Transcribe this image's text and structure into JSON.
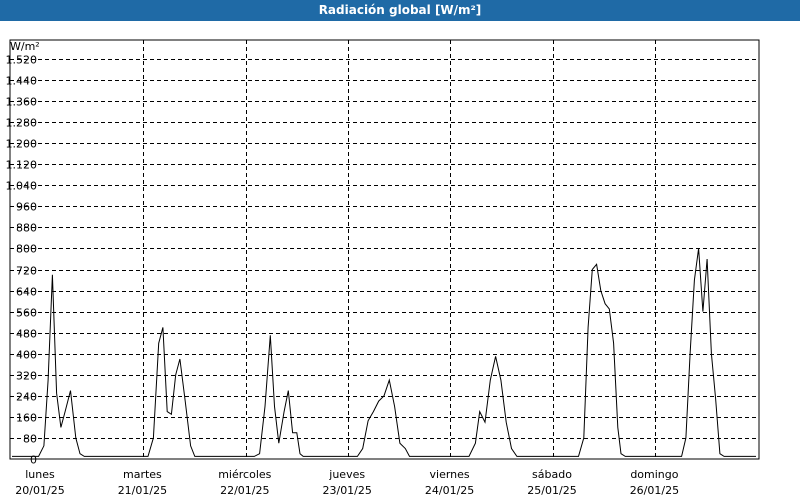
{
  "window": {
    "title": "Radiación global [W/m²]"
  },
  "chart_data": {
    "type": "line",
    "title": "Radiación global [W/m²]",
    "ylabel": "W/m²",
    "xlabel": "",
    "ylim": [
      0,
      1600
    ],
    "xlim": [
      0,
      7
    ],
    "grid": true,
    "legend": "none",
    "yticks": [
      0,
      80,
      160,
      240,
      320,
      400,
      480,
      560,
      640,
      720,
      800,
      880,
      960,
      1040,
      1120,
      1200,
      1280,
      1360,
      1440,
      1520
    ],
    "ytick_labels": [
      "0",
      "80",
      "160",
      "240",
      "320",
      "400",
      "480",
      "560",
      "640",
      "720",
      "800",
      "880",
      "960",
      "1.040",
      "1.120",
      "1.200",
      "1.280",
      "1.360",
      "1.440",
      "1.520"
    ],
    "xticks": [
      {
        "day": "lunes",
        "date": "20/01/25"
      },
      {
        "day": "martes",
        "date": "21/01/25"
      },
      {
        "day": "miércoles",
        "date": "22/01/25"
      },
      {
        "day": "jueves",
        "date": "23/01/25"
      },
      {
        "day": "viernes",
        "date": "24/01/25"
      },
      {
        "day": "sábado",
        "date": "25/01/25"
      },
      {
        "day": "domingo",
        "date": "26/01/25"
      }
    ],
    "series": [
      {
        "color": "#000000",
        "x": [
          0.0,
          0.25,
          0.3,
          0.34,
          0.38,
          0.42,
          0.46,
          0.5,
          0.55,
          0.6,
          0.64,
          0.68,
          0.71,
          0.75,
          0.8,
          1.0,
          1.28,
          1.33,
          1.38,
          1.42,
          1.46,
          1.5,
          1.54,
          1.58,
          1.63,
          1.68,
          1.72,
          1.76,
          1.81,
          2.0,
          2.28,
          2.33,
          2.38,
          2.43,
          2.47,
          2.51,
          2.56,
          2.6,
          2.64,
          2.68,
          2.71,
          2.74,
          2.78,
          3.0,
          3.25,
          3.3,
          3.35,
          3.4,
          3.45,
          3.5,
          3.55,
          3.6,
          3.65,
          3.7,
          3.74,
          3.79,
          4.0,
          4.3,
          4.36,
          4.4,
          4.45,
          4.5,
          4.55,
          4.6,
          4.65,
          4.7,
          4.75,
          4.81,
          5.0,
          5.33,
          5.38,
          5.42,
          5.46,
          5.5,
          5.54,
          5.58,
          5.62,
          5.66,
          5.7,
          5.73,
          5.77,
          6.0,
          6.3,
          6.34,
          6.38,
          6.42,
          6.46,
          6.5,
          6.54,
          6.58,
          6.62,
          6.66,
          6.7,
          6.74,
          6.78,
          7.0
        ],
        "y": [
          10,
          10,
          50,
          300,
          700,
          250,
          120,
          180,
          260,
          80,
          20,
          10,
          10,
          10,
          10,
          10,
          10,
          80,
          440,
          500,
          180,
          170,
          320,
          380,
          220,
          50,
          10,
          10,
          10,
          10,
          10,
          20,
          200,
          470,
          200,
          60,
          180,
          260,
          100,
          100,
          20,
          10,
          10,
          10,
          10,
          40,
          145,
          180,
          220,
          240,
          300,
          200,
          60,
          40,
          10,
          10,
          10,
          10,
          60,
          180,
          140,
          300,
          390,
          300,
          140,
          40,
          10,
          10,
          10,
          10,
          80,
          500,
          720,
          740,
          640,
          590,
          570,
          440,
          120,
          20,
          10,
          10,
          10,
          80,
          400,
          680,
          800,
          560,
          760,
          400,
          230,
          20,
          10,
          10,
          10,
          10
        ]
      }
    ]
  }
}
